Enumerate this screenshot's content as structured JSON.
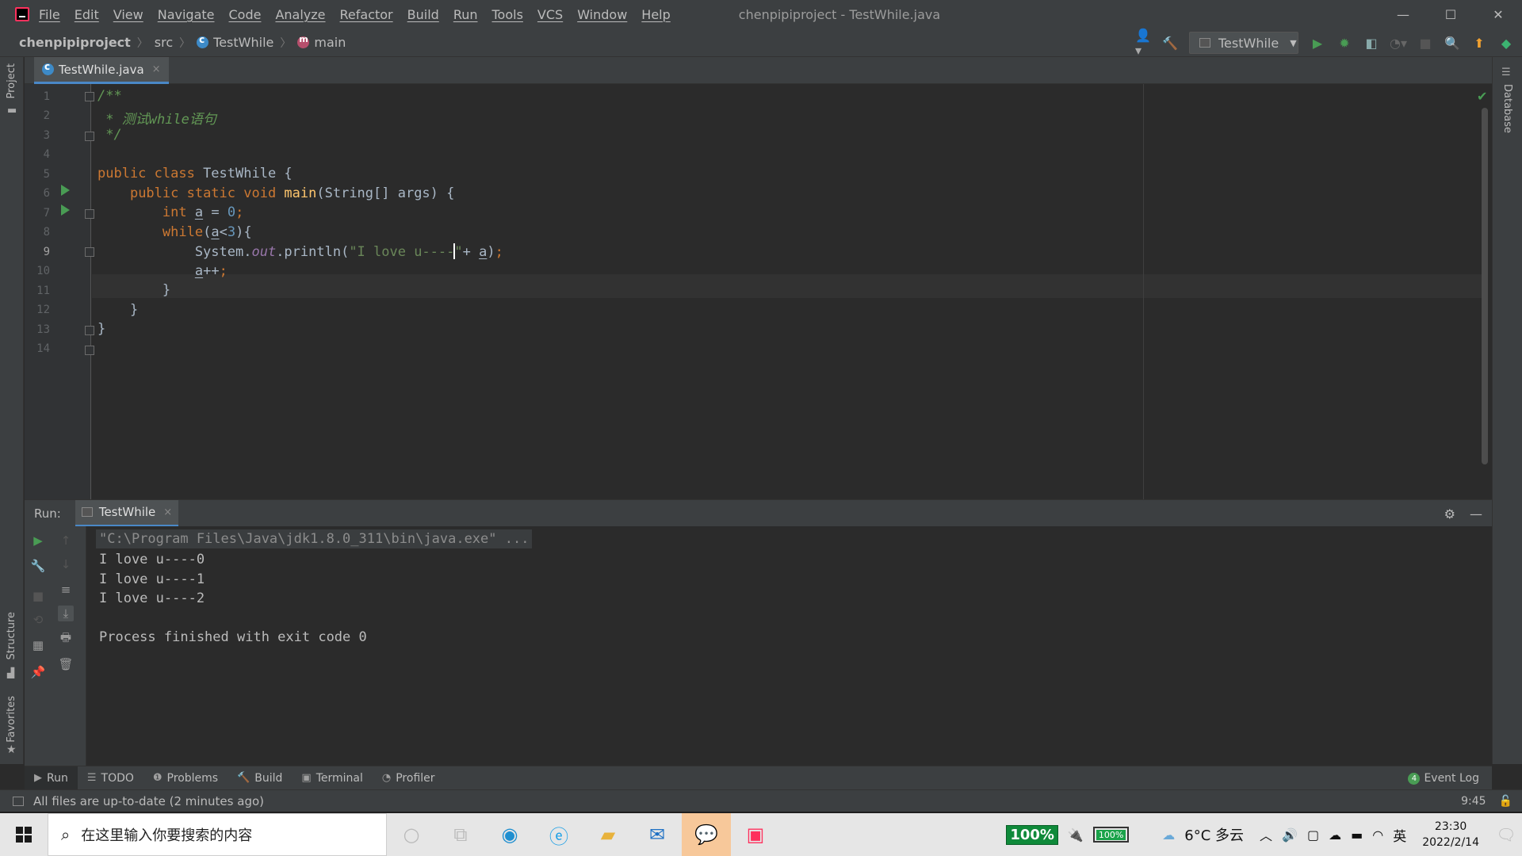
{
  "titlebar": {
    "menu": [
      "File",
      "Edit",
      "View",
      "Navigate",
      "Code",
      "Analyze",
      "Refactor",
      "Build",
      "Run",
      "Tools",
      "VCS",
      "Window",
      "Help"
    ],
    "window_title": "chenpipiproject - TestWhile.java",
    "minimize": "—",
    "maximize": "☐",
    "close": "✕"
  },
  "navbar": {
    "project": "chenpipiproject",
    "src": "src",
    "class": "TestWhile",
    "method": "main",
    "run_config": "TestWhile"
  },
  "left_strip": {
    "project": "Project",
    "structure": "Structure",
    "favorites": "Favorites"
  },
  "right_strip": {
    "database": "Database"
  },
  "editor_tab": {
    "label": "TestWhile.java",
    "close": "×"
  },
  "editor": {
    "line_numbers": [
      "1",
      "2",
      "3",
      "4",
      "5",
      "6",
      "7",
      "8",
      "9",
      "10",
      "11",
      "12",
      "13",
      "14"
    ],
    "current_line": "9"
  },
  "run_window": {
    "title": "Run:",
    "tab": "TestWhile",
    "close": "×",
    "console": [
      "\"C:\\Program Files\\Java\\jdk1.8.0_311\\bin\\java.exe\" ...",
      "I love u----0",
      "I love u----1",
      "I love u----2",
      "",
      "Process finished with exit code 0"
    ]
  },
  "tool_buttons": {
    "run": "Run",
    "todo": "TODO",
    "problems": "Problems",
    "build": "Build",
    "terminal": "Terminal",
    "profiler": "Profiler",
    "event_log": "Event Log",
    "event_count": "4"
  },
  "statusbar": {
    "message": "All files are up-to-date (2 minutes ago)",
    "position": "9:45"
  },
  "taskbar": {
    "search_placeholder": "在这里输入你要搜索的内容",
    "battery_left": "100%",
    "battery_right": "100%",
    "weather": "6°C 多云",
    "ime": "英",
    "time": "23:30",
    "date": "2022/2/14"
  },
  "colors": {
    "editor_bg": "#2b2b2b",
    "panel_bg": "#3c3f41",
    "keyword": "#cc7832",
    "string": "#6a8759",
    "number": "#6897bb",
    "method": "#ffc66d",
    "doc_comment": "#629755",
    "run_green": "#499c54"
  }
}
